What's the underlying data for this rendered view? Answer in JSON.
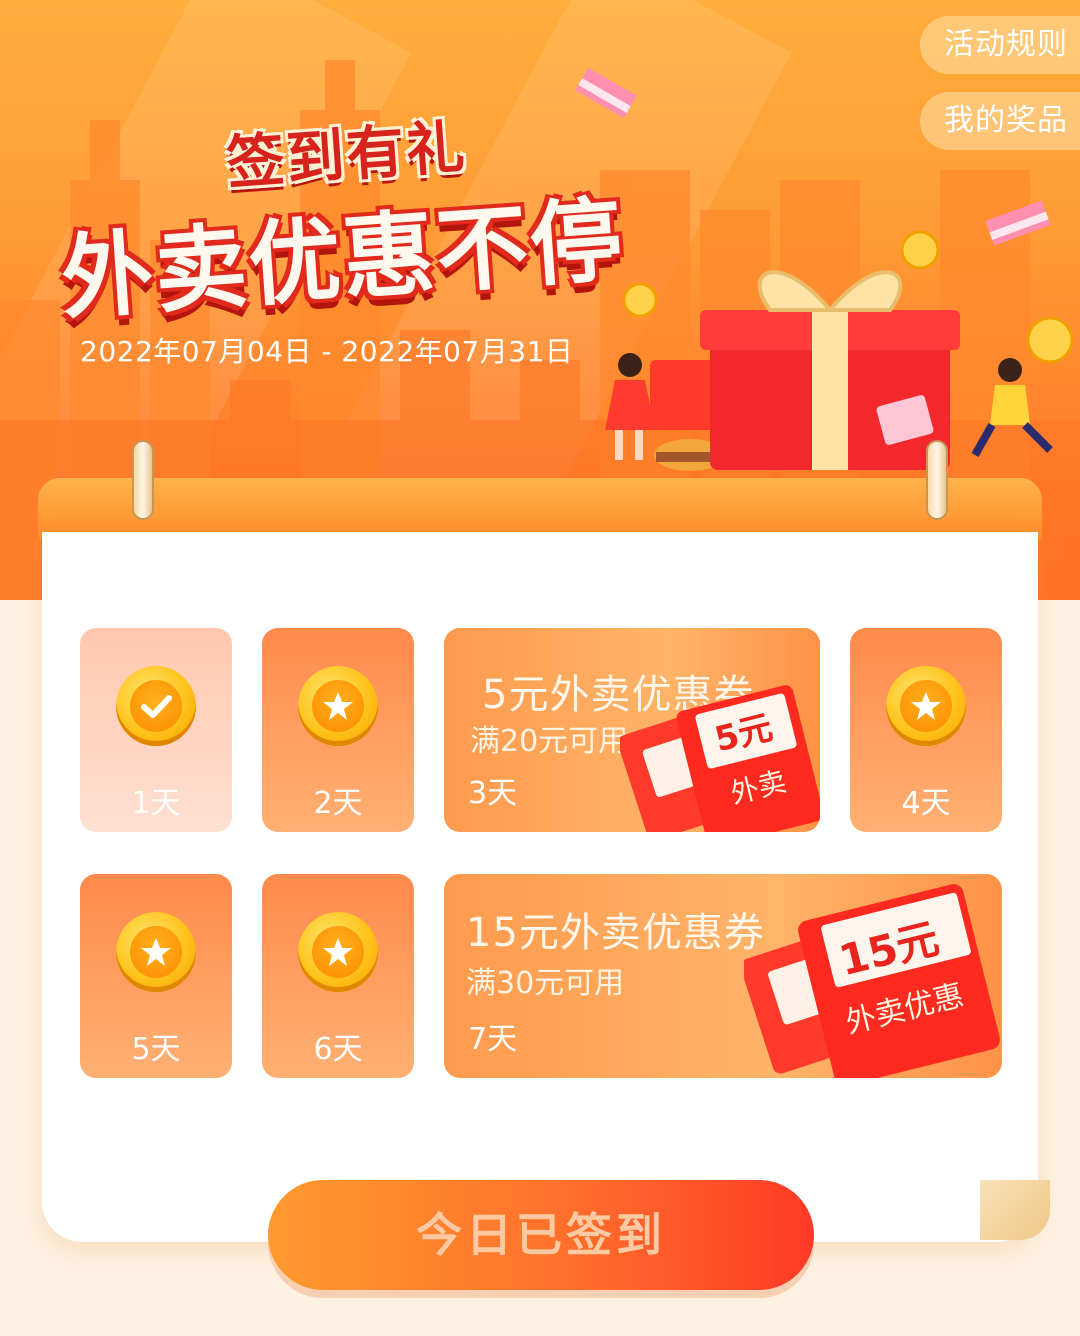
{
  "header": {
    "rules_label": "活动规则",
    "prizes_label": "我的奖品",
    "title_small": "签到有礼",
    "title_big": "外卖优惠不停",
    "date_range": "2022年07月04日 - 2022年07月31日"
  },
  "days": [
    {
      "label": "1天",
      "status": "checked"
    },
    {
      "label": "2天",
      "status": "pending"
    },
    {
      "label": "4天",
      "status": "pending"
    },
    {
      "label": "5天",
      "status": "pending"
    },
    {
      "label": "6天",
      "status": "pending"
    }
  ],
  "rewards": [
    {
      "title": "5元外卖优惠券",
      "condition": "满20元可用",
      "day": "3天",
      "envelope_amount": "5元",
      "envelope_text": "外卖"
    },
    {
      "title": "15元外卖优惠券",
      "condition": "满30元可用",
      "day": "7天",
      "envelope_amount": "15元",
      "envelope_text": "外卖优惠"
    }
  ],
  "button": {
    "label": "今日已签到"
  },
  "colors": {
    "accent": "#ff7a2a",
    "title_red": "#d8231c",
    "coin": "#ffc21a",
    "background": "#fdf1e2"
  },
  "icons": [
    "check-icon",
    "star-icon"
  ]
}
